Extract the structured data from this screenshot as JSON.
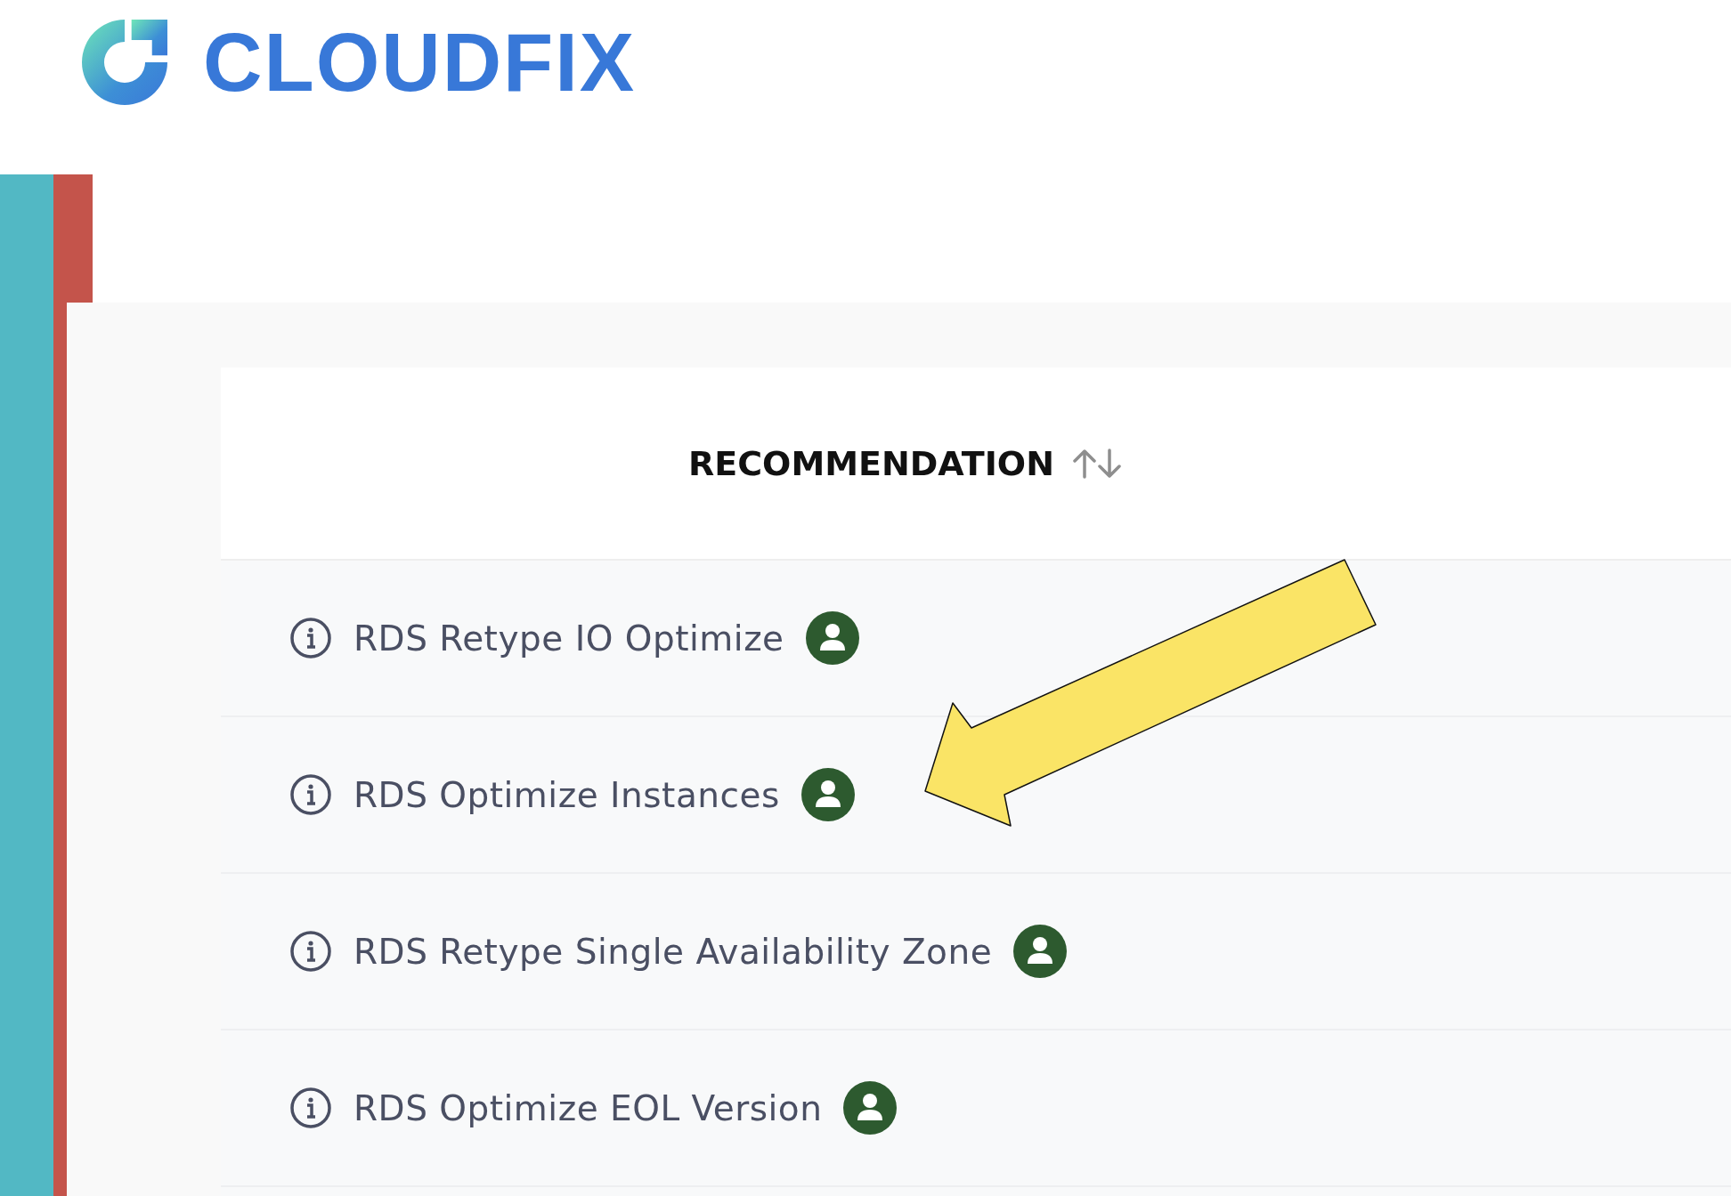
{
  "logo": {
    "text": "CLOUDFIX"
  },
  "table": {
    "columns": [
      {
        "label": "RECOMMENDATION"
      }
    ],
    "rows": [
      {
        "name": "RDS Retype IO Optimize"
      },
      {
        "name": "RDS Optimize Instances"
      },
      {
        "name": "RDS Retype Single Availability Zone"
      },
      {
        "name": "RDS Optimize EOL Version"
      }
    ]
  }
}
